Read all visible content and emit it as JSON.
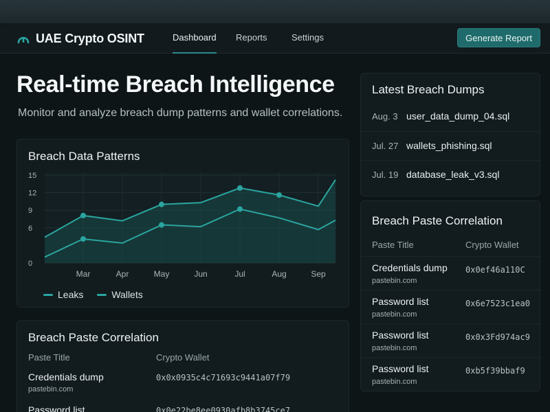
{
  "brand": {
    "name": "UAE Crypto OSINT",
    "icon": "radar-dome-icon"
  },
  "nav": {
    "tabs": [
      {
        "label": "Dashboard",
        "active": true
      },
      {
        "label": "Reports",
        "active": false
      },
      {
        "label": "Settings",
        "active": false
      }
    ],
    "cta_label": "Generate Report"
  },
  "hero": {
    "title": "Real-time Breach Intelligence",
    "subtitle": "Monitor and analyze breach dump patterns and wallet correlations."
  },
  "chart_card": {
    "title": "Breach Data Patterns"
  },
  "chart_data": {
    "type": "line",
    "title": "Breach Data Patterns",
    "x": [
      "Mar",
      "Apr",
      "May",
      "Jun",
      "Jul",
      "Aug",
      "Sep"
    ],
    "ylim": [
      0,
      15
    ],
    "yticks": [
      0,
      6,
      9,
      12,
      15
    ],
    "grid": true,
    "legend": "bottom-left",
    "series": [
      {
        "name": "Leaks",
        "values": [
          8.1,
          7.2,
          10.0,
          10.3,
          12.8,
          11.6,
          9.7
        ]
      },
      {
        "name": "Wallets",
        "values": [
          4.1,
          3.4,
          6.5,
          6.2,
          9.2,
          7.7,
          5.7
        ]
      }
    ],
    "colors": {
      "line": "#2aa5a0",
      "fill": "#1a4a49"
    }
  },
  "corr_left": {
    "title": "Breach Paste Correlation",
    "col_title": "Paste Title",
    "col_wallet": "Crypto Wallet",
    "rows": [
      {
        "title": "Credentials dump",
        "source": "pastebin.com",
        "wallet": "0x0x0935c4c71693c9441a07f79"
      },
      {
        "title": "Password list",
        "source": "",
        "wallet": "0x0e22be8ee0930afb8b3745ce7"
      }
    ]
  },
  "dumps": {
    "title": "Latest Breach Dumps",
    "items": [
      {
        "date": "Aug. 3",
        "file": "user_data_dump_04.sql"
      },
      {
        "date": "Jul. 27",
        "file": "wallets_phishing.sql"
      },
      {
        "date": "Jul. 19",
        "file": "database_leak_v3.sql"
      }
    ]
  },
  "corr_right": {
    "title": "Breach Paste Correlation",
    "col_title": "Paste Title",
    "col_wallet": "Crypto Wallet",
    "rows": [
      {
        "title": "Credentials dump",
        "source": "pastebin.com",
        "wallet": "0x0ef46a110C"
      },
      {
        "title": "Password list",
        "source": "pastebin.com",
        "wallet": "0x6e7523c1ea0"
      },
      {
        "title": "Password list",
        "source": "pastebin.com",
        "wallet": "0x0x3Fd974ac9"
      },
      {
        "title": "Password list",
        "source": "pastebin.com",
        "wallet": "0xb5f39bbaf9"
      }
    ]
  }
}
